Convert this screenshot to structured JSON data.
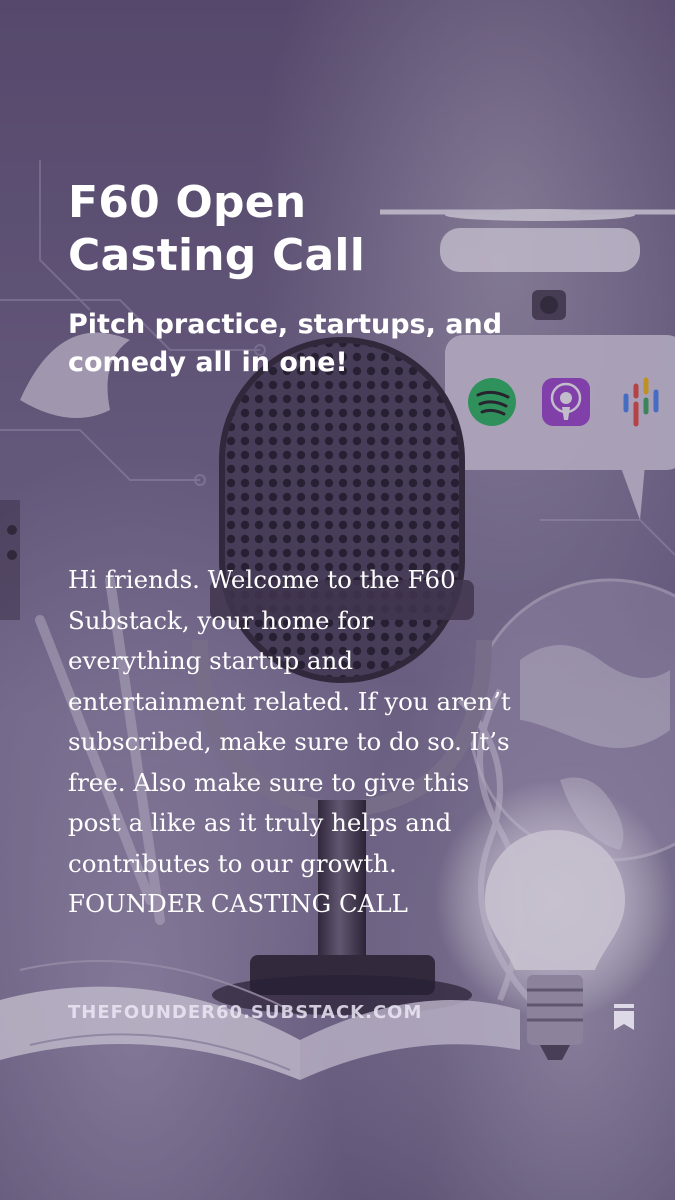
{
  "post": {
    "title": "F60 Open Casting Call",
    "subtitle": "Pitch practice, startups, and comedy all in one!",
    "excerpt": "Hi friends. Welcome to the F60 Substack, your home for everything startup and entertainment related. If you aren’t subscribed, make sure to do so. It’s free. Also make sure to give this post a like as it truly helps and contributes to our growth. FOUNDER CASTING CALL"
  },
  "footer": {
    "domain": "THEFOUNDER60.SUBSTACK.COM",
    "bookmark_icon": "bookmark-icon"
  },
  "background": {
    "icons": [
      "microphone-icon",
      "drone-icon",
      "spotify-icon",
      "apple-podcasts-icon",
      "google-podcasts-icon",
      "lightbulb-icon",
      "open-book-icon",
      "globe-icon"
    ]
  },
  "colors": {
    "overlay": "#5d5072",
    "text": "#ffffff",
    "spotify": "#1db954",
    "apple_podcasts": "#9b3dcc"
  }
}
